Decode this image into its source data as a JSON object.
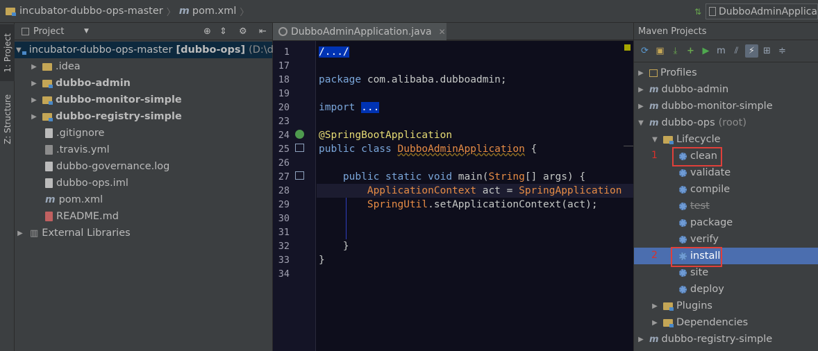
{
  "navbar": {
    "project": "incubator-dubbo-ops-master",
    "file": "pom.xml",
    "run_config": "DubboAdminApplica"
  },
  "toolstrip": {
    "project_tab": "1: Project",
    "structure_tab": "Z: Structure"
  },
  "project_panel": {
    "header": "Project",
    "root_name": "incubator-dubbo-ops-master",
    "root_module": "[dubbo-ops]",
    "root_path": "(D:\\du",
    "items": [
      {
        "label": "idea",
        "prefix": ".",
        "kind": "folder"
      },
      {
        "label": "dubbo-admin",
        "kind": "module"
      },
      {
        "label": "dubbo-monitor-simple",
        "kind": "module"
      },
      {
        "label": "dubbo-registry-simple",
        "kind": "module"
      },
      {
        "label": ".gitignore",
        "kind": "file"
      },
      {
        "label": ".travis.yml",
        "kind": "file"
      },
      {
        "label": "dubbo-governance.log",
        "kind": "file"
      },
      {
        "label": "dubbo-ops.iml",
        "kind": "file"
      },
      {
        "label": "pom.xml",
        "kind": "maven"
      },
      {
        "label": "README.md",
        "kind": "file"
      }
    ],
    "external_libraries": "External Libraries"
  },
  "editor": {
    "tab": "DubboAdminApplication.java",
    "line_numbers": [
      "1",
      "17",
      "18",
      "19",
      "20",
      "23",
      "24",
      "25",
      "26",
      "27",
      "28",
      "29",
      "30",
      "31",
      "32",
      "33",
      "34"
    ],
    "code": {
      "l1": "/.../",
      "l18_kw": "package",
      "l18_rest": " com.alibaba.dubboadmin;",
      "l20_kw": "import",
      "l20_fold": "...",
      "l24": "@SpringBootApplication",
      "l25_kw": "public class ",
      "l25_cls": "DubboAdminApplication",
      "l25_rest": " {",
      "l27_kw": "public static void ",
      "l27_name": "main(",
      "l27_type": "String",
      "l27_rest": "[] args) {",
      "l28_type": "ApplicationContext",
      "l28_mid": " act = ",
      "l28_call": "SpringApplication",
      "l29_cls": "SpringUtil",
      "l29_rest": ".setApplicationContext(act);",
      "l32": "}",
      "l33": "}"
    }
  },
  "maven_panel": {
    "header": "Maven Projects",
    "items": [
      {
        "label": "Profiles"
      },
      {
        "label": "dubbo-admin"
      },
      {
        "label": "dubbo-monitor-simple"
      },
      {
        "label": "dubbo-ops",
        "suffix": "(root)"
      },
      {
        "label": "Lifecycle"
      },
      {
        "label": "clean"
      },
      {
        "label": "validate"
      },
      {
        "label": "compile"
      },
      {
        "label": "test"
      },
      {
        "label": "package"
      },
      {
        "label": "verify"
      },
      {
        "label": "install"
      },
      {
        "label": "site"
      },
      {
        "label": "deploy"
      },
      {
        "label": "Plugins"
      },
      {
        "label": "Dependencies"
      },
      {
        "label": "dubbo-registry-simple"
      }
    ],
    "markers": {
      "first": "1",
      "second": "2"
    }
  }
}
